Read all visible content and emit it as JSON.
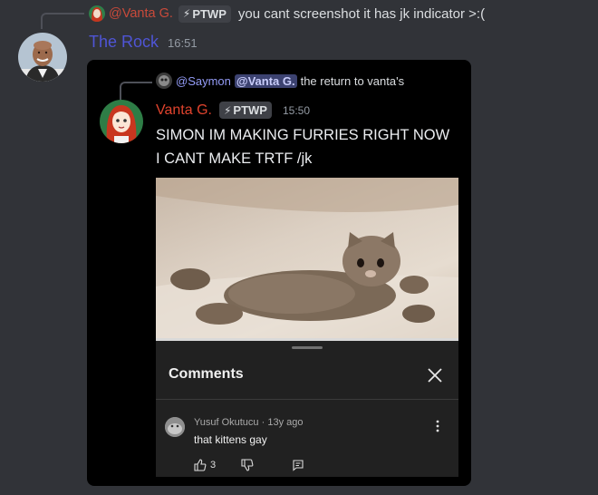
{
  "outer_reply": {
    "author": "@Vanta G.",
    "tag": "PTWP",
    "text": "you cant screenshot it has jk indicator >:("
  },
  "outer_message": {
    "author": "The Rock",
    "time": "16:51"
  },
  "embed": {
    "reply": {
      "mention_user": "@Saymon",
      "mention_target": "@Vanta G.",
      "text": "the return to vanta's"
    },
    "author": "Vanta G.",
    "tag": "PTWP",
    "time": "15:50",
    "message": "SIMON IM MAKING FURRIES RIGHT NOW I CANT MAKE TRTF /jk",
    "comments_sheet": {
      "title": "Comments",
      "comment": {
        "author": "Yusuf Okutucu",
        "age": "13y ago",
        "text": "that kittens gay",
        "likes": "3"
      }
    }
  },
  "colors": {
    "background": "#313338",
    "rock_name": "#4f55d6",
    "vanta_name": "#e0432d",
    "mention": "#949cf7",
    "sheet": "#212121"
  },
  "icons": [
    "lightning-icon",
    "close-icon",
    "more-vert-icon",
    "thumbs-up-icon",
    "thumbs-down-icon",
    "reply-icon"
  ]
}
